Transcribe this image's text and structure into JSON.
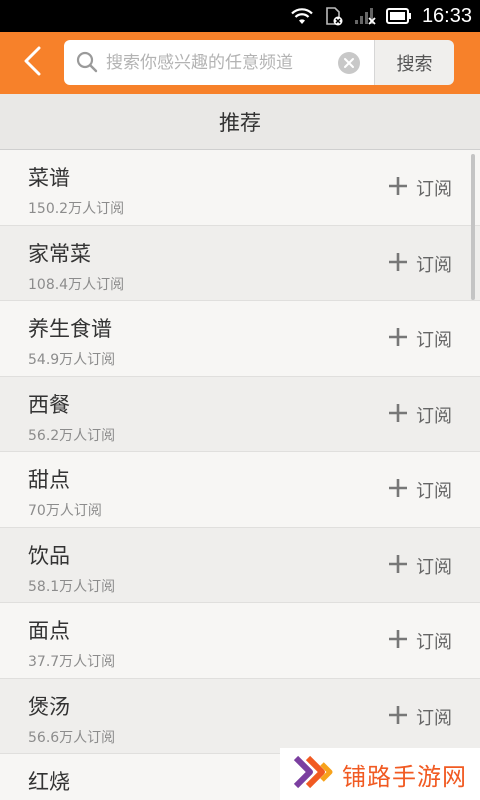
{
  "status_bar": {
    "time": "16:33"
  },
  "header": {
    "search_placeholder": "搜索你感兴趣的任意频道",
    "search_button": "搜索"
  },
  "section": {
    "title": "推荐"
  },
  "channels": [
    {
      "name": "菜谱",
      "subscribers": "150.2万人订阅",
      "subscribe_label": "订阅"
    },
    {
      "name": "家常菜",
      "subscribers": "108.4万人订阅",
      "subscribe_label": "订阅"
    },
    {
      "name": "养生食谱",
      "subscribers": "54.9万人订阅",
      "subscribe_label": "订阅"
    },
    {
      "name": "西餐",
      "subscribers": "56.2万人订阅",
      "subscribe_label": "订阅"
    },
    {
      "name": "甜点",
      "subscribers": "70万人订阅",
      "subscribe_label": "订阅"
    },
    {
      "name": "饮品",
      "subscribers": "58.1万人订阅",
      "subscribe_label": "订阅"
    },
    {
      "name": "面点",
      "subscribers": "37.7万人订阅",
      "subscribe_label": "订阅"
    },
    {
      "name": "煲汤",
      "subscribers": "56.6万人订阅",
      "subscribe_label": "订阅"
    },
    {
      "name": "红烧",
      "subscribers": "",
      "subscribe_label": ""
    }
  ],
  "watermark": {
    "text": "铺路手游网"
  },
  "colors": {
    "header_bg": "#f7812a",
    "watermark_orange": "#f15a22",
    "watermark_purple": "#7b3fa0"
  },
  "icons": {
    "back": "chevron-left-icon",
    "search": "search-icon",
    "clear": "clear-icon",
    "subscribe": "plus-icon",
    "wifi": "wifi-icon",
    "sim": "sim-card-icon",
    "signal": "signal-icon",
    "battery": "battery-icon"
  }
}
